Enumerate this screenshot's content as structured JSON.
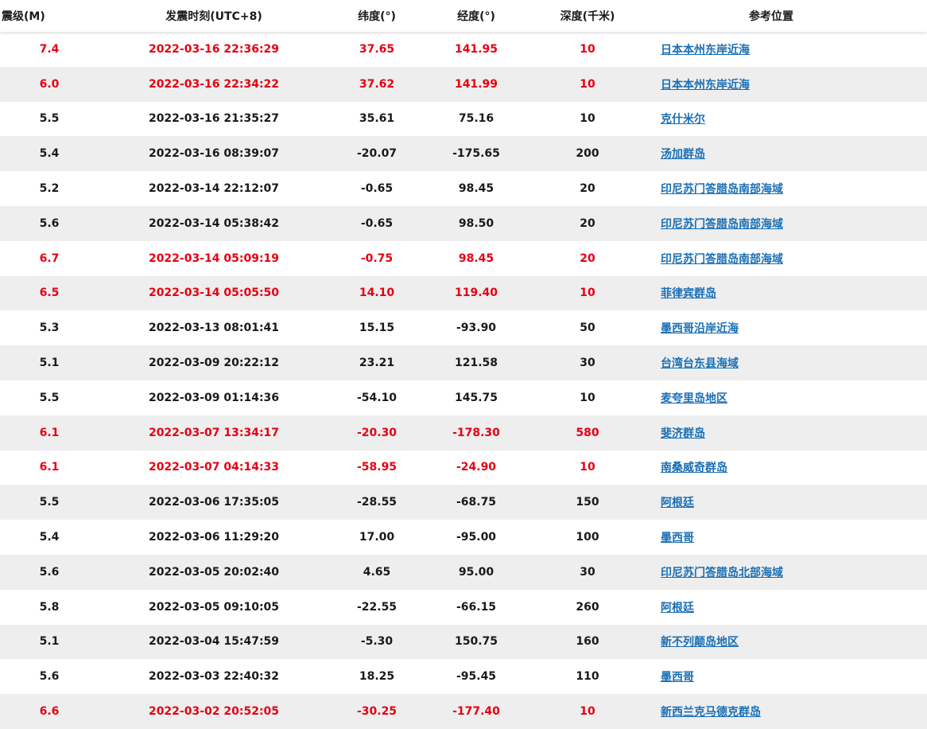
{
  "colors": {
    "strong_quake_text": "#e60012",
    "normal_text": "#1a1a1a",
    "link": "#1a6fb5",
    "row_alt_bg": "#eeeeee"
  },
  "headers": {
    "magnitude": "震级(M)",
    "time": "发震时刻(UTC+8)",
    "latitude": "纬度(°)",
    "longitude": "经度(°)",
    "depth": "深度(千米)",
    "location": "参考位置"
  },
  "rows": [
    {
      "magnitude": "7.4",
      "time": "2022-03-16 22:36:29",
      "latitude": "37.65",
      "longitude": "141.95",
      "depth": "10",
      "location": "日本本州东岸近海",
      "highlight": true
    },
    {
      "magnitude": "6.0",
      "time": "2022-03-16 22:34:22",
      "latitude": "37.62",
      "longitude": "141.99",
      "depth": "10",
      "location": "日本本州东岸近海",
      "highlight": true
    },
    {
      "magnitude": "5.5",
      "time": "2022-03-16 21:35:27",
      "latitude": "35.61",
      "longitude": "75.16",
      "depth": "10",
      "location": "克什米尔",
      "highlight": false
    },
    {
      "magnitude": "5.4",
      "time": "2022-03-16 08:39:07",
      "latitude": "-20.07",
      "longitude": "-175.65",
      "depth": "200",
      "location": "汤加群岛",
      "highlight": false
    },
    {
      "magnitude": "5.2",
      "time": "2022-03-14 22:12:07",
      "latitude": "-0.65",
      "longitude": "98.45",
      "depth": "20",
      "location": "印尼苏门答腊岛南部海域",
      "highlight": false
    },
    {
      "magnitude": "5.6",
      "time": "2022-03-14 05:38:42",
      "latitude": "-0.65",
      "longitude": "98.50",
      "depth": "20",
      "location": "印尼苏门答腊岛南部海域",
      "highlight": false
    },
    {
      "magnitude": "6.7",
      "time": "2022-03-14 05:09:19",
      "latitude": "-0.75",
      "longitude": "98.45",
      "depth": "20",
      "location": "印尼苏门答腊岛南部海域",
      "highlight": true
    },
    {
      "magnitude": "6.5",
      "time": "2022-03-14 05:05:50",
      "latitude": "14.10",
      "longitude": "119.40",
      "depth": "10",
      "location": "菲律宾群岛",
      "highlight": true
    },
    {
      "magnitude": "5.3",
      "time": "2022-03-13 08:01:41",
      "latitude": "15.15",
      "longitude": "-93.90",
      "depth": "50",
      "location": "墨西哥沿岸近海",
      "highlight": false
    },
    {
      "magnitude": "5.1",
      "time": "2022-03-09 20:22:12",
      "latitude": "23.21",
      "longitude": "121.58",
      "depth": "30",
      "location": "台湾台东县海域",
      "highlight": false
    },
    {
      "magnitude": "5.5",
      "time": "2022-03-09 01:14:36",
      "latitude": "-54.10",
      "longitude": "145.75",
      "depth": "10",
      "location": "麦夸里岛地区",
      "highlight": false
    },
    {
      "magnitude": "6.1",
      "time": "2022-03-07 13:34:17",
      "latitude": "-20.30",
      "longitude": "-178.30",
      "depth": "580",
      "location": "斐济群岛",
      "highlight": true
    },
    {
      "magnitude": "6.1",
      "time": "2022-03-07 04:14:33",
      "latitude": "-58.95",
      "longitude": "-24.90",
      "depth": "10",
      "location": "南桑威奇群岛",
      "highlight": true
    },
    {
      "magnitude": "5.5",
      "time": "2022-03-06 17:35:05",
      "latitude": "-28.55",
      "longitude": "-68.75",
      "depth": "150",
      "location": "阿根廷",
      "highlight": false
    },
    {
      "magnitude": "5.4",
      "time": "2022-03-06 11:29:20",
      "latitude": "17.00",
      "longitude": "-95.00",
      "depth": "100",
      "location": "墨西哥",
      "highlight": false
    },
    {
      "magnitude": "5.6",
      "time": "2022-03-05 20:02:40",
      "latitude": "4.65",
      "longitude": "95.00",
      "depth": "30",
      "location": "印尼苏门答腊岛北部海域",
      "highlight": false
    },
    {
      "magnitude": "5.8",
      "time": "2022-03-05 09:10:05",
      "latitude": "-22.55",
      "longitude": "-66.15",
      "depth": "260",
      "location": "阿根廷",
      "highlight": false
    },
    {
      "magnitude": "5.1",
      "time": "2022-03-04 15:47:59",
      "latitude": "-5.30",
      "longitude": "150.75",
      "depth": "160",
      "location": "新不列颠岛地区",
      "highlight": false
    },
    {
      "magnitude": "5.6",
      "time": "2022-03-03 22:40:32",
      "latitude": "18.25",
      "longitude": "-95.45",
      "depth": "110",
      "location": "墨西哥",
      "highlight": false
    },
    {
      "magnitude": "6.6",
      "time": "2022-03-02 20:52:05",
      "latitude": "-30.25",
      "longitude": "-177.40",
      "depth": "10",
      "location": "新西兰克马德克群岛",
      "highlight": true
    }
  ]
}
